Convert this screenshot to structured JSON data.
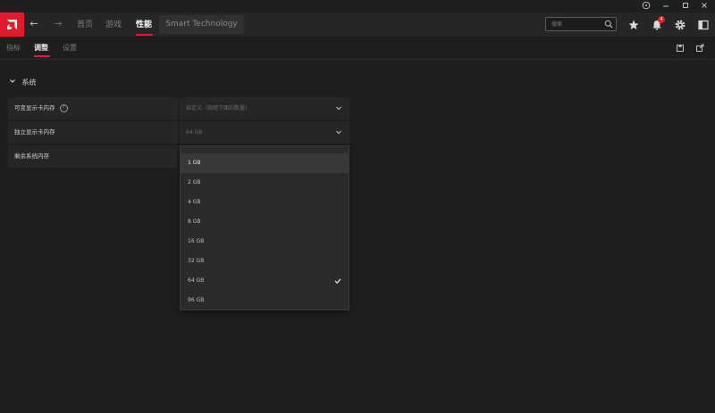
{
  "titlebar": {
    "controls": [
      "help-icon",
      "minimize-icon",
      "maximize-icon",
      "close-icon"
    ]
  },
  "header": {
    "tabs": [
      {
        "label": "首页",
        "active": false
      },
      {
        "label": "游戏",
        "active": false
      },
      {
        "label": "性能",
        "active": true
      }
    ],
    "smart_tab": "Smart Technology",
    "search_placeholder": "搜索",
    "notification_count": "4",
    "accent": "#e01b2b"
  },
  "subnav": {
    "tabs": [
      {
        "label": "指标",
        "active": false
      },
      {
        "label": "调整",
        "active": true
      },
      {
        "label": "设置",
        "active": false
      }
    ]
  },
  "section": {
    "title": "系统"
  },
  "rows": [
    {
      "label": "可变显示卡内存",
      "value": "自定义（指明下面的数量）",
      "has_help": true
    },
    {
      "label": "独立显示卡内存",
      "value": "64 GB",
      "has_help": false
    },
    {
      "label": "剩余系统内存",
      "value": "",
      "has_help": false
    }
  ],
  "dropdown": {
    "options": [
      "1 GB",
      "2 GB",
      "4 GB",
      "8 GB",
      "16 GB",
      "32 GB",
      "64 GB",
      "96 GB"
    ],
    "selected": "64 GB",
    "hovered": "1 GB"
  }
}
